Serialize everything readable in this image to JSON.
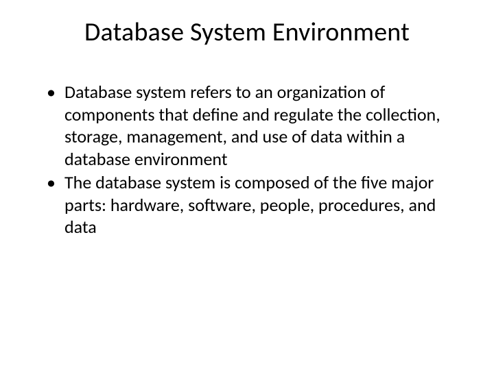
{
  "title": "Database System Environment",
  "bullets": [
    "Database system refers to an organization of components that define and regulate the collection, storage, management, and use of data within a database environment",
    "The database system is composed of the five major parts: hardware, software, people, procedures, and data"
  ]
}
